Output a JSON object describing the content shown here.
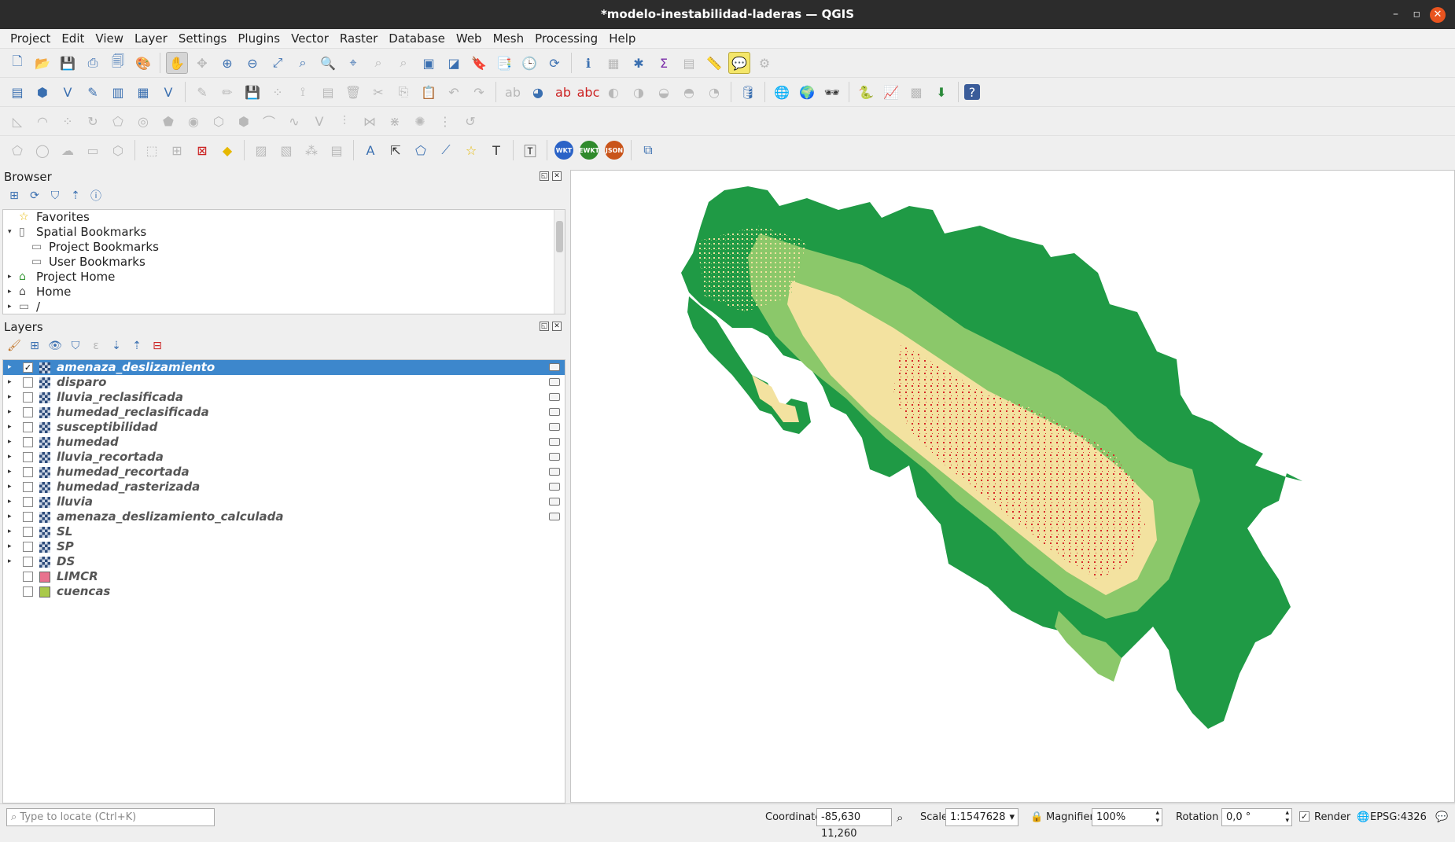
{
  "window": {
    "title": "*modelo-inestabilidad-laderas — QGIS",
    "minimize": "–",
    "restore": "▫",
    "close": "✕"
  },
  "menu": [
    "Project",
    "Edit",
    "View",
    "Layer",
    "Settings",
    "Plugins",
    "Vector",
    "Raster",
    "Database",
    "Web",
    "Mesh",
    "Processing",
    "Help"
  ],
  "badges": {
    "wkt": "WKT",
    "ewkt": "EWKT",
    "json": "JSON"
  },
  "browser": {
    "title": "Browser",
    "items": [
      {
        "label": "Favorites",
        "icon": "star-icon",
        "expand": ""
      },
      {
        "label": "Spatial Bookmarks",
        "icon": "bookmark-icon",
        "expand": "▾"
      },
      {
        "label": "Project Bookmarks",
        "icon": "folder-icon",
        "expand": "",
        "indent": 1
      },
      {
        "label": "User Bookmarks",
        "icon": "folder-icon",
        "expand": "",
        "indent": 1
      },
      {
        "label": "Project Home",
        "icon": "project-home-icon",
        "expand": "▸"
      },
      {
        "label": "Home",
        "icon": "home-icon",
        "expand": "▸"
      },
      {
        "label": "/",
        "icon": "folder-icon",
        "expand": "▸"
      }
    ]
  },
  "layers": {
    "title": "Layers",
    "items": [
      {
        "name": "amenaza_deslizamiento",
        "checked": true,
        "selected": true,
        "type": "raster",
        "indicator": true
      },
      {
        "name": "disparo",
        "checked": false,
        "type": "raster",
        "indicator": true
      },
      {
        "name": "lluvia_reclasificada",
        "checked": false,
        "type": "raster",
        "indicator": true
      },
      {
        "name": "humedad_reclasificada",
        "checked": false,
        "type": "raster",
        "indicator": true
      },
      {
        "name": "susceptibilidad",
        "checked": false,
        "type": "raster",
        "indicator": true
      },
      {
        "name": "humedad",
        "checked": false,
        "type": "raster",
        "indicator": true
      },
      {
        "name": "lluvia_recortada",
        "checked": false,
        "type": "raster",
        "indicator": true
      },
      {
        "name": "humedad_recortada",
        "checked": false,
        "type": "raster",
        "indicator": true
      },
      {
        "name": "humedad_rasterizada",
        "checked": false,
        "type": "raster",
        "indicator": true
      },
      {
        "name": "lluvia",
        "checked": false,
        "type": "raster",
        "indicator": true
      },
      {
        "name": "amenaza_deslizamiento_calculada",
        "checked": false,
        "type": "raster",
        "indicator": true
      },
      {
        "name": "SL",
        "checked": false,
        "type": "raster",
        "indicator": false
      },
      {
        "name": "SP",
        "checked": false,
        "type": "raster",
        "indicator": false
      },
      {
        "name": "DS",
        "checked": false,
        "type": "raster",
        "indicator": false
      },
      {
        "name": "LIMCR",
        "checked": false,
        "type": "polygon",
        "color": "#e8728e",
        "indicator": false
      },
      {
        "name": "cuencas",
        "checked": false,
        "type": "polygon",
        "color": "#a9c94a",
        "indicator": false
      }
    ]
  },
  "map": {
    "colors": {
      "green": "#1f9a45",
      "lightgreen": "#8bc86a",
      "yellow": "#f3e2a0",
      "red": "#d62a2a"
    }
  },
  "status": {
    "locate_placeholder": "Type to locate (Ctrl+K)",
    "coordinate_label": "Coordinate",
    "coordinate": "-85,630 11,260",
    "scale_label": "Scale",
    "scale": "1:1547628",
    "magnifier_label": "Magnifier",
    "magnifier": "100%",
    "rotation_label": "Rotation",
    "rotation": "0,0 °",
    "render_label": "Render",
    "crs": "EPSG:4326"
  }
}
